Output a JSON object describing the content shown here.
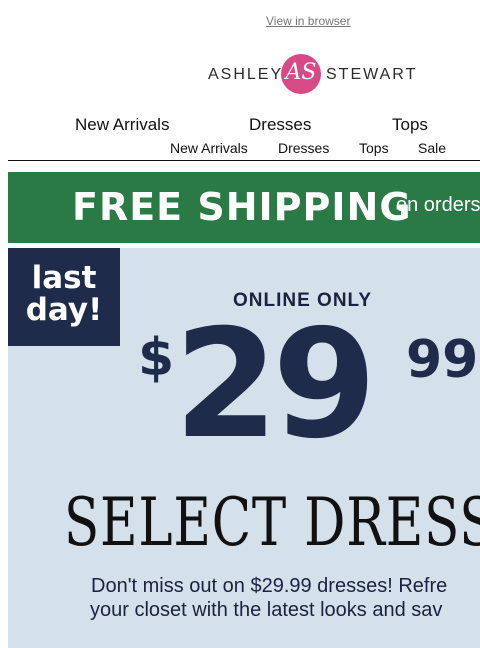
{
  "preheader": {
    "view_in_browser": "View in browser"
  },
  "logo": {
    "left": "ASHLEY",
    "monogram": "AS",
    "right": "STEWART",
    "circle_color": "#d84a86"
  },
  "nav_primary": [
    "New Arrivals",
    "Dresses",
    "Tops"
  ],
  "nav_secondary": [
    "New Arrivals",
    "Dresses",
    "Tops",
    "Sale"
  ],
  "shipping_banner": {
    "headline": "FREE SHIPPING",
    "subtext": "on orders",
    "color": "#2a7a45"
  },
  "hero": {
    "badge_line1": "last",
    "badge_line2": "day!",
    "tag": "ONLINE ONLY",
    "currency": "$",
    "price_main": "29",
    "price_cents": "99",
    "headline": "SELECT DRESS",
    "body_line1": "Don't miss out on $29.99 dresses! Refre",
    "body_line2": "your closet with the latest looks and sav",
    "bg_color": "#d4e0ea",
    "badge_color": "#1f2b4b"
  }
}
